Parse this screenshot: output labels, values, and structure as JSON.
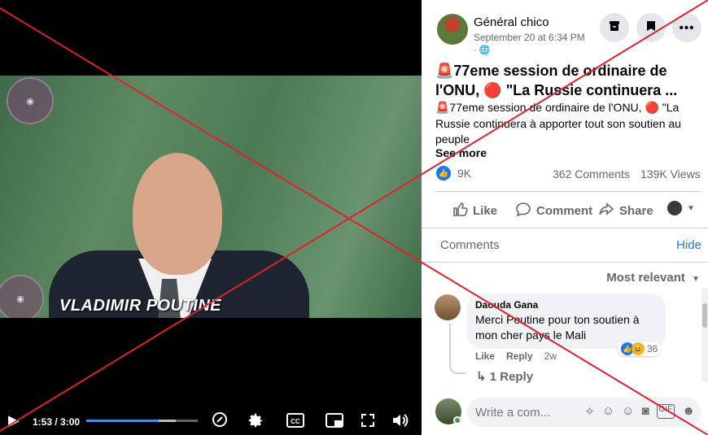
{
  "video": {
    "caption_name": "VLADIMIR POUTINE",
    "time": "1:53 / 3:00",
    "progress": 0.65,
    "buffered": 0.8
  },
  "post": {
    "author": "Général chico",
    "date": "September 20 at 6:34 PM",
    "privacy_dot": "·",
    "title": "🚨77eme session de ordinaire de l'ONU, 🔴 \"La Russie continuera ...",
    "body": "🚨77eme session de ordinaire de l'ONU, 🔴 \"La Russie continuera à apporter tout son soutien au peuple",
    "see_more": "See more",
    "reactions_count": "9K",
    "comments_count": "362 Comments",
    "views_count": "139K Views"
  },
  "actions": {
    "like": "Like",
    "comment": "Comment",
    "share": "Share"
  },
  "comments_section": {
    "label": "Comments",
    "hide": "Hide",
    "sort": "Most relevant",
    "comment": {
      "name": "Daouda Gana",
      "text": "Merci Poutine pour ton soutien à mon cher pays le Mali",
      "reaction_count": "36",
      "like": "Like",
      "reply": "Reply",
      "time": "2w"
    },
    "replies_link": "↳ 1 Reply",
    "write_placeholder": "Write a com..."
  },
  "colors": {
    "facebook_blue": "#1877f2",
    "x_mark": "#e0222a"
  }
}
